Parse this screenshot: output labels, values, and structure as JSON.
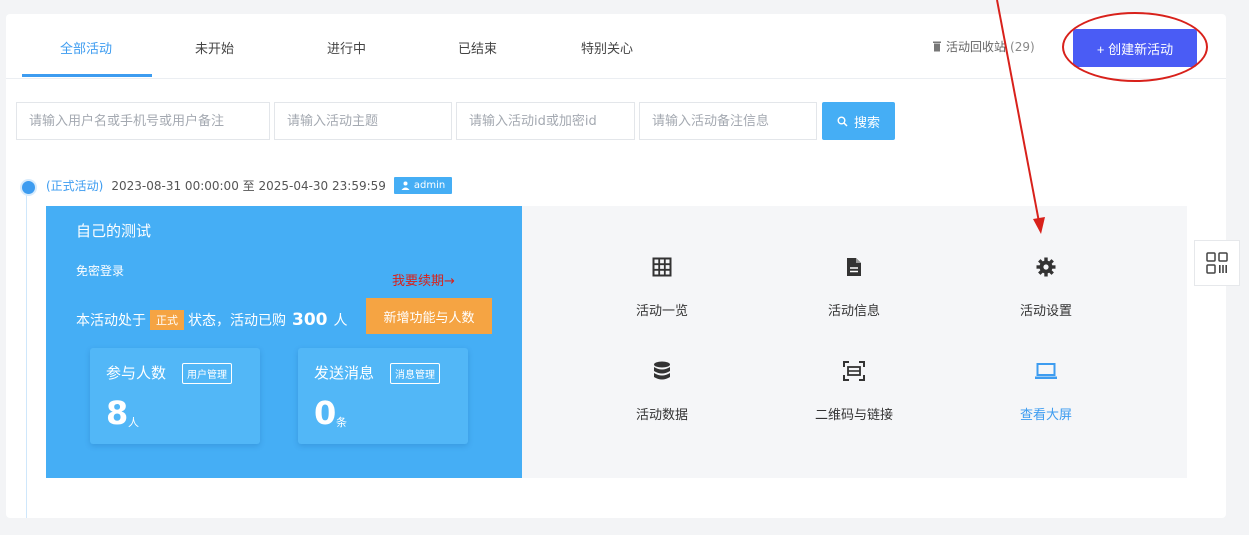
{
  "tabs": [
    {
      "label": "全部活动",
      "active": true
    },
    {
      "label": "未开始"
    },
    {
      "label": "进行中"
    },
    {
      "label": "已结束"
    },
    {
      "label": "特别关心"
    }
  ],
  "recycle": {
    "label": "活动回收站",
    "count": "(29)"
  },
  "create_button": {
    "label": "+ 创建新活动"
  },
  "search": {
    "user_placeholder": "请输入用户名或手机号或用户备注",
    "topic_placeholder": "请输入活动主题",
    "id_placeholder": "请输入活动id或加密id",
    "note_placeholder": "请输入活动备注信息",
    "button_label": "搜索"
  },
  "activity": {
    "type_label": "(正式活动)",
    "time_range": "2023-08-31 00:00:00 至 2025-04-30 23:59:59",
    "owner": "admin",
    "title": "自己的测试",
    "login_type": "免密登录",
    "renew_link": "我要续期→",
    "status_prefix": "本活动处于",
    "status_tag": "正式",
    "status_middle": "状态，活动已购",
    "purchased": "300",
    "purchased_unit": "人",
    "upgrade_button": "新增功能与人数",
    "participants": {
      "label": "参与人数",
      "tag": "用户管理",
      "value": "8",
      "unit": "人"
    },
    "messages": {
      "label": "发送消息",
      "tag": "消息管理",
      "value": "0",
      "unit": "条"
    }
  },
  "grid": [
    {
      "label": "活动一览",
      "icon": "table-icon"
    },
    {
      "label": "活动信息",
      "icon": "document-icon"
    },
    {
      "label": "活动设置",
      "icon": "gear-icon"
    },
    {
      "label": "活动数据",
      "icon": "database-icon"
    },
    {
      "label": "二维码与链接",
      "icon": "scan-icon"
    },
    {
      "label": "查看大屏",
      "icon": "laptop-icon"
    }
  ],
  "colors": {
    "primary": "#45aef5",
    "accent": "#4a5cf5",
    "warning": "#f5a443",
    "annotation": "#d8211b"
  }
}
